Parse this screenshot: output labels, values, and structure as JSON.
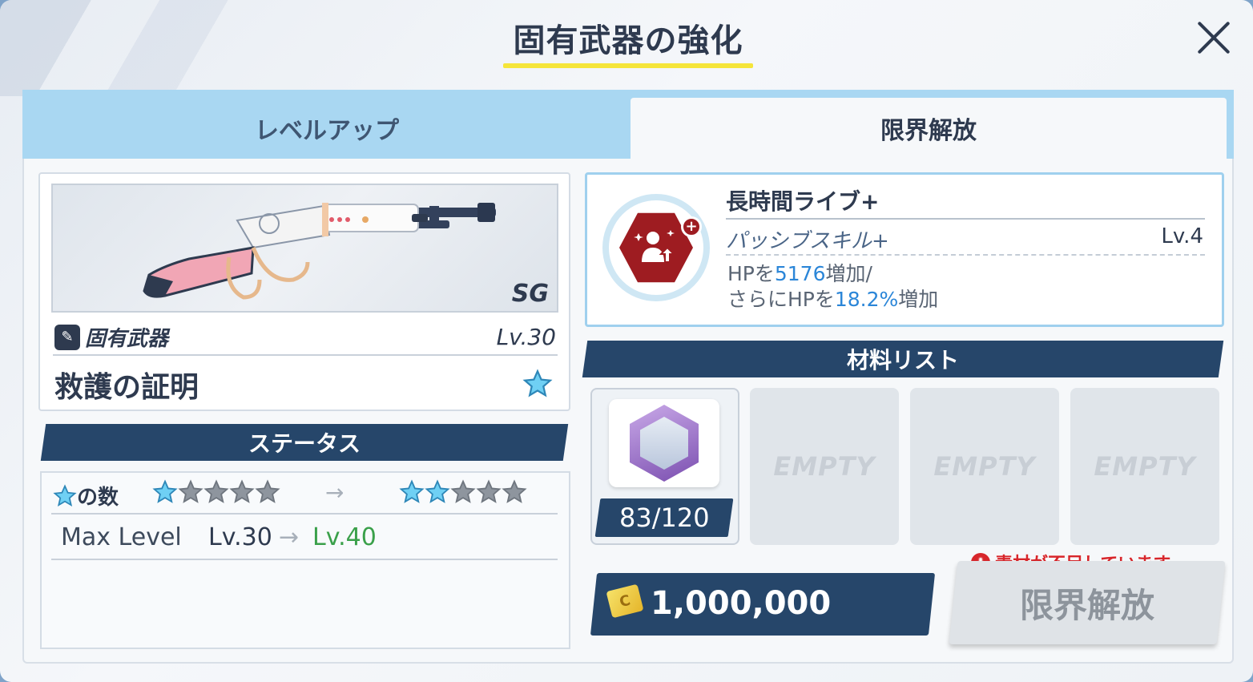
{
  "header": {
    "title": "固有武器の強化"
  },
  "tabs": [
    {
      "label": "レベルアップ",
      "active": false
    },
    {
      "label": "限界解放",
      "active": true
    }
  ],
  "weapon": {
    "class": "SG",
    "type_label": "固有武器",
    "level": "Lv.30",
    "name": "救護の証明"
  },
  "status": {
    "section_title": "ステータス",
    "stars_label": "の数",
    "stars_current": 1,
    "stars_next": 2,
    "stars_max": 5,
    "max_level_label": "Max Level",
    "max_level_from": "Lv.30",
    "max_level_to": "Lv.40"
  },
  "skill": {
    "name": "長時間ライブ+",
    "type": "パッシブスキル+",
    "level": "Lv.4",
    "desc1_pre": "HPを",
    "desc1_val": "5176",
    "desc1_post": "増加/",
    "desc2_pre": "さらにHPを",
    "desc2_val": "18.2%",
    "desc2_post": "増加"
  },
  "materials": {
    "section_title": "材料リスト",
    "owned": "83",
    "required": "/120",
    "empty_label": "EMPTY"
  },
  "warning": "素材が不足しています。",
  "cost": "1,000,000",
  "limit_button": "限界解放",
  "colors": {
    "accent_blue": "#2b86d8",
    "warning_red": "#d7262b",
    "navy": "#26466a",
    "tab_blue": "#a9d7f2"
  }
}
